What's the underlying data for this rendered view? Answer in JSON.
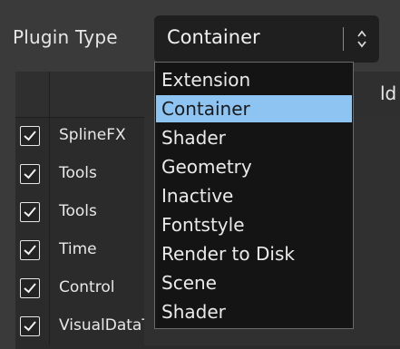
{
  "toolbar": {
    "label": "Plugin Type",
    "selected_value": "Container"
  },
  "table": {
    "header_truncated": "ld",
    "rows": [
      {
        "checked": true,
        "name": "SplineFX"
      },
      {
        "checked": true,
        "name": "Tools"
      },
      {
        "checked": true,
        "name": "Tools"
      },
      {
        "checked": true,
        "name": "Time"
      },
      {
        "checked": true,
        "name": "Control"
      },
      {
        "checked": true,
        "name": "VisualDataTools"
      }
    ]
  },
  "dropdown": {
    "options": [
      "Extension",
      "Container",
      "Shader",
      "Geometry",
      "Inactive",
      "Fontstyle",
      "Render to Disk",
      "Scene",
      "Shader"
    ],
    "selected_index": 1
  },
  "colors": {
    "background": "#3a3a3a",
    "select_bg": "#1f1f1f",
    "dropdown_bg": "#141414",
    "highlight": "#8ec4f2"
  }
}
